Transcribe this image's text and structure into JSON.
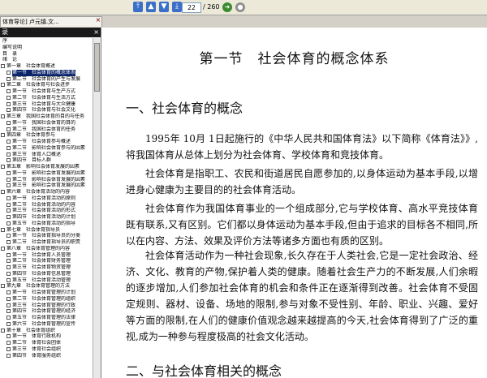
{
  "toolbar": {
    "page_current": "22",
    "page_total": "/ 260"
  },
  "tab": {
    "label": "体育导论] 卢元镇.文...",
    "close": "×"
  },
  "sidebar": {
    "header": "录",
    "close": "×",
    "toc": [
      {
        "label": "序",
        "box": false,
        "indent": 0
      },
      {
        "label": "编写说明",
        "box": false,
        "indent": 0
      },
      {
        "label": "目　录",
        "box": false,
        "indent": 0
      },
      {
        "label": "绪　论",
        "box": false,
        "indent": 0
      },
      {
        "label": "第一章　社会体育概述",
        "box": true,
        "indent": 0
      },
      {
        "label": "第一节　社会体育的概念体系",
        "box": true,
        "indent": 1,
        "selected": true
      },
      {
        "label": "第二节　社会体育的产生与发展",
        "box": true,
        "indent": 1
      },
      {
        "label": "第二章　社会体育与社会进步",
        "box": true,
        "indent": 0
      },
      {
        "label": "第一节　社会体育与生产方式",
        "box": true,
        "indent": 1
      },
      {
        "label": "第二节　社会体育与生活方式",
        "box": true,
        "indent": 1
      },
      {
        "label": "第三节　社会体育与大众健康",
        "box": true,
        "indent": 1
      },
      {
        "label": "第四节　社会体育与社会文化",
        "box": true,
        "indent": 1
      },
      {
        "label": "第三章　我国社会体育的目的与任务",
        "box": true,
        "indent": 0
      },
      {
        "label": "第一节　我国社会体育的目的",
        "box": true,
        "indent": 1
      },
      {
        "label": "第二节　我国社会体育的任务",
        "box": true,
        "indent": 1
      },
      {
        "label": "第四章　社会体育参与",
        "box": true,
        "indent": 0
      },
      {
        "label": "第一节　社会体育参与概述",
        "box": true,
        "indent": 1
      },
      {
        "label": "第二节　影响社会体育参与的因素",
        "box": true,
        "indent": 1
      },
      {
        "label": "第三节　体育人口概述",
        "box": true,
        "indent": 1
      },
      {
        "label": "第四节　目标人群",
        "box": true,
        "indent": 1
      },
      {
        "label": "第五章　影响社会体育发展的因素",
        "box": true,
        "indent": 0
      },
      {
        "label": "第一节　影响社会体育发展的因素",
        "box": true,
        "indent": 1
      },
      {
        "label": "第二节　影响社会体育发展的因素",
        "box": true,
        "indent": 1
      },
      {
        "label": "第三节　影响社会体育发展的因素",
        "box": true,
        "indent": 1
      },
      {
        "label": "第六章　社会体育活动的内容",
        "box": true,
        "indent": 0
      },
      {
        "label": "第一节　社会体育活动的原则",
        "box": true,
        "indent": 1
      },
      {
        "label": "第二节　社会体育活动的内容",
        "box": true,
        "indent": 1
      },
      {
        "label": "第三节　社会体育活动的形式",
        "box": true,
        "indent": 1
      },
      {
        "label": "第四节　社会体育活动的计划",
        "box": true,
        "indent": 1
      },
      {
        "label": "第五节　社会体育活动的指导",
        "box": true,
        "indent": 1
      },
      {
        "label": "第七章　社会体育指导员",
        "box": true,
        "indent": 0
      },
      {
        "label": "第一节　社会体育指导员的分类",
        "box": true,
        "indent": 1
      },
      {
        "label": "第二节　社会体育指导员的职责",
        "box": true,
        "indent": 1
      },
      {
        "label": "第八章　社会体育管理的内容",
        "box": true,
        "indent": 0
      },
      {
        "label": "第一节　社会体育人员管理",
        "box": true,
        "indent": 1
      },
      {
        "label": "第二节　社会体育财务管理",
        "box": true,
        "indent": 1
      },
      {
        "label": "第三节　社会体育物资管理",
        "box": true,
        "indent": 1
      },
      {
        "label": "第四节　社会体育信息管理",
        "box": true,
        "indent": 1
      },
      {
        "label": "第五节　社会体育活动管理",
        "box": true,
        "indent": 1
      },
      {
        "label": "第九章　社会体育管理的方法",
        "box": true,
        "indent": 0
      },
      {
        "label": "第一节　社会体育管理的计划",
        "box": true,
        "indent": 1
      },
      {
        "label": "第二节　社会体育管理的组织",
        "box": true,
        "indent": 1
      },
      {
        "label": "第三节　社会体育管理的行政",
        "box": true,
        "indent": 1
      },
      {
        "label": "第四节　社会体育管理的经济",
        "box": true,
        "indent": 1
      },
      {
        "label": "第五节　社会体育管理的法律",
        "box": true,
        "indent": 1
      },
      {
        "label": "第六节　社会体育管理的宣传",
        "box": true,
        "indent": 1
      },
      {
        "label": "第十章　社会体育组织",
        "box": true,
        "indent": 0
      },
      {
        "label": "第一节　体育行政机构",
        "box": true,
        "indent": 1
      },
      {
        "label": "第二节　体育社会团体",
        "box": true,
        "indent": 1
      },
      {
        "label": "第三节　体育社会组织",
        "box": true,
        "indent": 1
      },
      {
        "label": "第四节　体育服务组织",
        "box": true,
        "indent": 1
      }
    ]
  },
  "document": {
    "title": "第一节　社会体育的概念体系",
    "section1_heading": "一、社会体育的概念",
    "paragraphs": [
      "1995年 10月 1日起施行的《中华人民共和国体育法》以下简称《体育法》》,将我国体育从总体上划分为社会体育、学校体育和竞技体育。",
      "社会体育是指职工、农民和街道居民自愿参加的,以身体运动为基本手段,以增进身心健康为主要目的的社会体育活动。",
      "社会体育作为我国体育事业的一个组成部分,它与学校体育、高水平竞技体育既有联系,又有区别。它们都以身体运动为基本手段,但由于追求的目标各不相同,所以在内容、方法、效果及评价方法等诸多方面也有质的区别。",
      "社会体育活动作为一种社会现象,长久存在于人类社会,它是一定社会政治、经济、文化、教育的产物,保护着人类的健康。随着社会生产力的不断发展,人们余暇的逐步增加,人们参加社会体育的机会和条件正在逐渐得到改善。社会体育不受固定规则、器材、设备、场地的限制,参与对象不受性别、年龄、职业、兴趣、爱好等方面的限制,在人们的健康价值观念越来越提高的今天,社会体育得到了广泛的重视,成为一种参与程度极高的社会文化活动。"
    ],
    "section2_heading": "二、与社会体育相关的概念"
  }
}
